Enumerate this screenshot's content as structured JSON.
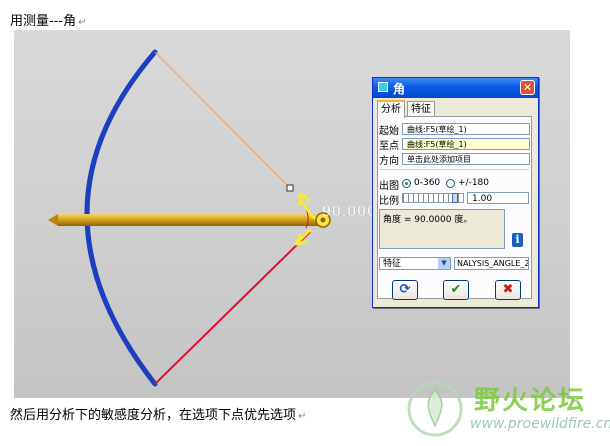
{
  "doc": {
    "top_text": "用测量---角",
    "bottom_text": "然后用分析下的敏感度分析，在选项下点优先选项",
    "para_mark": "↵"
  },
  "viewport": {
    "dimension_text": "90.0000"
  },
  "dialog": {
    "title": "角",
    "close_glyph": "✕",
    "tabs": [
      "分析",
      "特征"
    ],
    "start_label": "起始",
    "start_value": "曲线:F5(草绘_1)",
    "end_label": "至点",
    "end_value": "曲线:F5(草绘_1)",
    "direction_label": "方向",
    "direction_value": "单击此处添加项目",
    "output_label": "出图",
    "radio_0_360": "0-360",
    "radio_pm_180": "+/-180",
    "radio_selected": "0-360",
    "ratio_label": "比例",
    "ratio_value": "1.00",
    "ratio_level": 0.9,
    "result_text": "角度 = 90.0000 度。",
    "info_glyph": "i",
    "feature_type": "特征",
    "feature_name": "NALYSIS_ANGLE_2",
    "buttons": {
      "repeat_glyph": "⟳",
      "ok_glyph": "✔",
      "cancel_glyph": "✖"
    }
  },
  "watermark": {
    "name": "野火论坛",
    "url": "www.proewildfire.cn"
  },
  "colors": {
    "arc": "#1a3fbf",
    "shaft": "#d4a017",
    "top_line": "#f0a060",
    "bottom_line": "#e0102a",
    "dialog_title": "#0a5ae6"
  },
  "icons": {
    "title": "dialog-app-icon",
    "close": "close-icon",
    "info": "info-icon",
    "repeat": "repeat-icon",
    "ok": "checkmark-icon",
    "cancel": "cancel-icon"
  }
}
